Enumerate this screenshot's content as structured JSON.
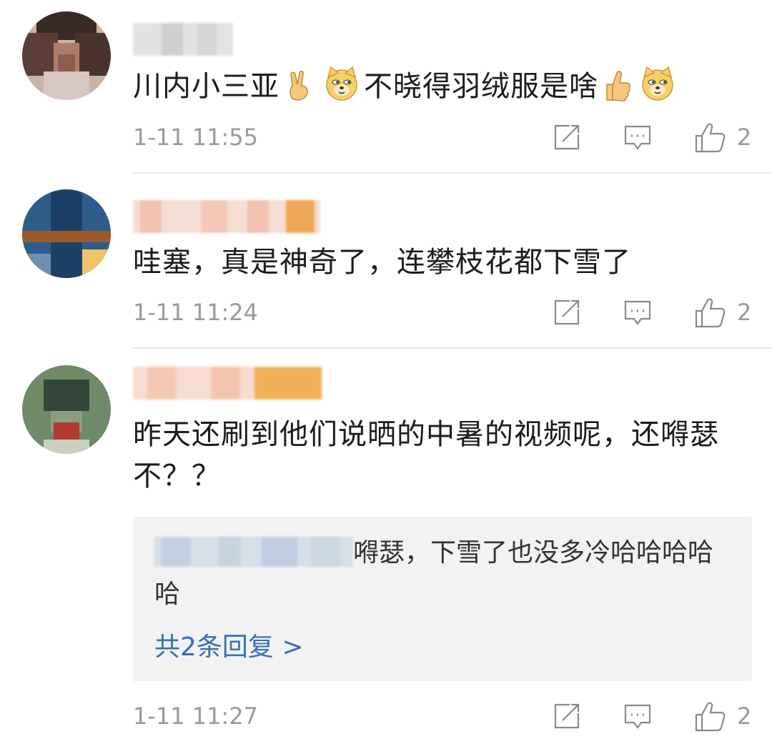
{
  "comments": [
    {
      "text": "川内小三亚",
      "text_after_victory": "不晓得羽绒服是啥",
      "time": "1-11 11:55",
      "likes": "2",
      "emojis": [
        "victory-hand-emoji",
        "doge-emoji",
        "thumbs-up-emoji",
        "doge-emoji"
      ]
    },
    {
      "text": "哇塞，真是神奇了，连攀枝花都下雪了",
      "time": "1-11 11:24",
      "likes": "2"
    },
    {
      "text": "昨天还刷到他们说晒的中暑的视频呢，还嘚瑟不？？",
      "time": "1-11 11:27",
      "likes": "2",
      "reply": {
        "text": "嘚瑟，下雪了也没多冷哈哈哈哈哈",
        "more": "共2条回复 >"
      }
    }
  ],
  "icons": {
    "share": "share-icon",
    "comment": "comment-icon",
    "like": "like-icon"
  },
  "colors": {
    "text": "#1c1c1c",
    "meta": "#9a9a9a",
    "link": "#3a6fb0",
    "reply_bg": "#f2f2f2",
    "divider": "#e9e9e9"
  }
}
